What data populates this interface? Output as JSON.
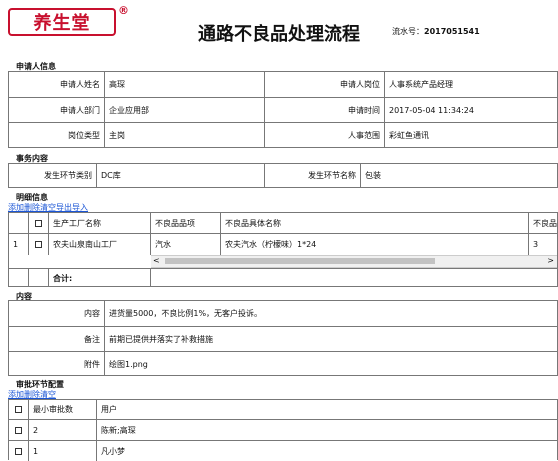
{
  "header": {
    "logo_text": "养生堂",
    "logo_reg": "®",
    "title": "通路不良品处理流程",
    "serial_label": "流水号：",
    "serial_value": "2017051541"
  },
  "applicant": {
    "section_title": "申请人信息",
    "name_label": "申请人姓名",
    "name_value": "高琛",
    "position_label": "申请人岗位",
    "position_value": "人事系统产品经理",
    "dept_label": "申请人部门",
    "dept_value": "企业应用部",
    "time_label": "申请时间",
    "time_value": "2017-05-04 11:34:24",
    "postype_label": "岗位类型",
    "postype_value": "主岗",
    "hrscope_label": "人事范围",
    "hrscope_value": "彩虹鱼通讯"
  },
  "business": {
    "section_title": "事务内容",
    "stage_type_label": "发生环节类别",
    "stage_type_value": "DC库",
    "stage_name_label": "发生环节名称",
    "stage_name_value": "包装"
  },
  "detail": {
    "section_title": "明细信息",
    "actions": [
      "添加",
      "删除",
      "清空",
      "导出",
      "导入"
    ],
    "columns": [
      "生产工厂名称",
      "不良品品项",
      "不良品具体名称",
      "不良品"
    ],
    "rows": [
      {
        "index": "1",
        "factory": "农夫山泉南山工厂",
        "item": "汽水",
        "name": "农夫汽水（柠檬味）1*24",
        "qty": "3"
      }
    ],
    "total_label": "合计:",
    "scroll_left": "<",
    "scroll_right": ">"
  },
  "content": {
    "section_title": "内容",
    "content_label": "内容",
    "content_value": "进货量5000，不良比例1%，无客户投诉。",
    "remark_label": "备注",
    "remark_value": "前期已提供并落实了补救措施",
    "attach_label": "附件",
    "attach_value": "绘图1.png"
  },
  "approval": {
    "section_title": "审批环节配置",
    "actions": [
      "添加",
      "删除",
      "清空"
    ],
    "columns": [
      "最小审批数",
      "用户"
    ],
    "rows": [
      {
        "min": "2",
        "users": "陈新;高琛"
      },
      {
        "min": "1",
        "users": "凡小梦"
      }
    ]
  },
  "colors": {
    "brand": "#c8102e",
    "link": "#1a55d6"
  }
}
